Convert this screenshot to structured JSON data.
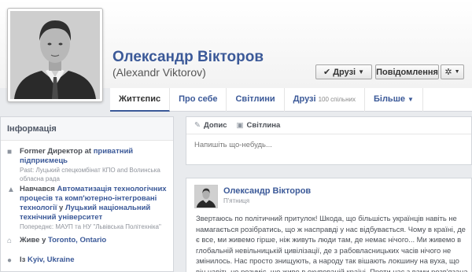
{
  "profile": {
    "name": "Олександр Вікторов",
    "alt_name": "(Alexandr Viktorov)"
  },
  "actions": {
    "friends_label": "Друзі",
    "message_label": "Повідомлення"
  },
  "tabs": [
    {
      "label": "Життєпис"
    },
    {
      "label": "Про себе"
    },
    {
      "label": "Світлини"
    },
    {
      "label": "Друзі",
      "count": "100 спільних"
    },
    {
      "label": "Більше"
    }
  ],
  "info": {
    "heading": "Інформація",
    "items": [
      {
        "icon": "briefcase-icon",
        "prefix": "Former Директор at ",
        "link": "приватний підприємець",
        "sub": "Past: Луцький спецкомбінат КПО and Волинська обласна рада"
      },
      {
        "icon": "education-icon",
        "prefix": "Навчався ",
        "link": "Автоматизація технологічних процесів та комп'ютерно-інтегровані технології",
        "mid": " у ",
        "link2": "Луцький національний технічний університет",
        "sub": "Попереднє: МАУП та НУ \"Львівська Політехніка\""
      },
      {
        "icon": "home-icon",
        "prefix": "Живе у ",
        "link": "Toronto, Ontario"
      },
      {
        "icon": "location-icon",
        "prefix": "Із ",
        "link": "Kyiv, Ukraine"
      }
    ]
  },
  "composer": {
    "status_tab": "Допис",
    "photo_tab": "Світлина",
    "placeholder": "Напишіть що-небудь..."
  },
  "post": {
    "author": "Олександр Вікторов",
    "date": "П'ятниця",
    "text": "Звертаюсь по політичний притулок! Шкода, що більшість українців навіть не намагається розібратись, що ж насправді у нас відбувається. Чому в країні, де є все, ми живемо гірше, ніж живуть люди там, де немає нічого... Ми живемо в глобальній невільницькій цивілізації, де з рабовласницьких часів нічого не змінилось. Нас просто знищують, а народу так вішають локшину на вуха, що він навіть не розуміє, що живе в окупованій країні. Проти нас з вами розв'язана"
  }
}
